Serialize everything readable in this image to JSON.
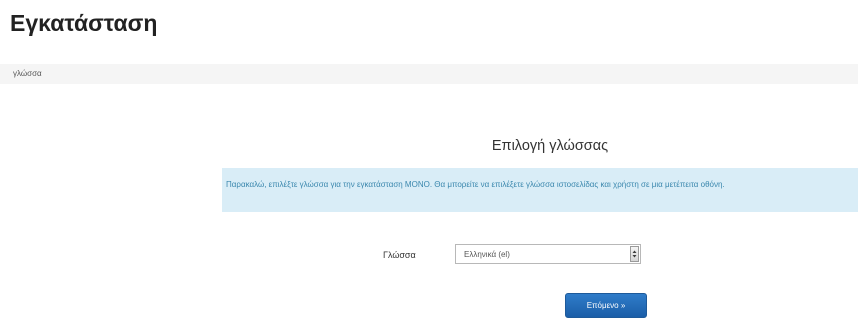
{
  "header": {
    "title": "Εγκατάσταση"
  },
  "breadcrumb": {
    "items": [
      "γλώσσα"
    ]
  },
  "language_section": {
    "heading": "Επιλογή γλώσσας",
    "info_text": "Παρακαλώ, επιλέξτε γλώσσα για την εγκατάσταση ΜΟΝΟ. Θα μπορείτε να επιλέξετε γλώσσα ιστοσελίδας και χρήστη σε μια μετέπειτα οθόνη.",
    "field_label": "Γλώσσα",
    "selected_language": "Ελληνικά (el)",
    "select_arrow_icon": "chevron-down-icon",
    "next_button_label": "Επόμενο »"
  },
  "colors": {
    "info_background": "#d9edf7",
    "info_text": "#3a87ad",
    "button_primary": "#2a74c0",
    "breadcrumb_background": "#f5f5f5"
  }
}
